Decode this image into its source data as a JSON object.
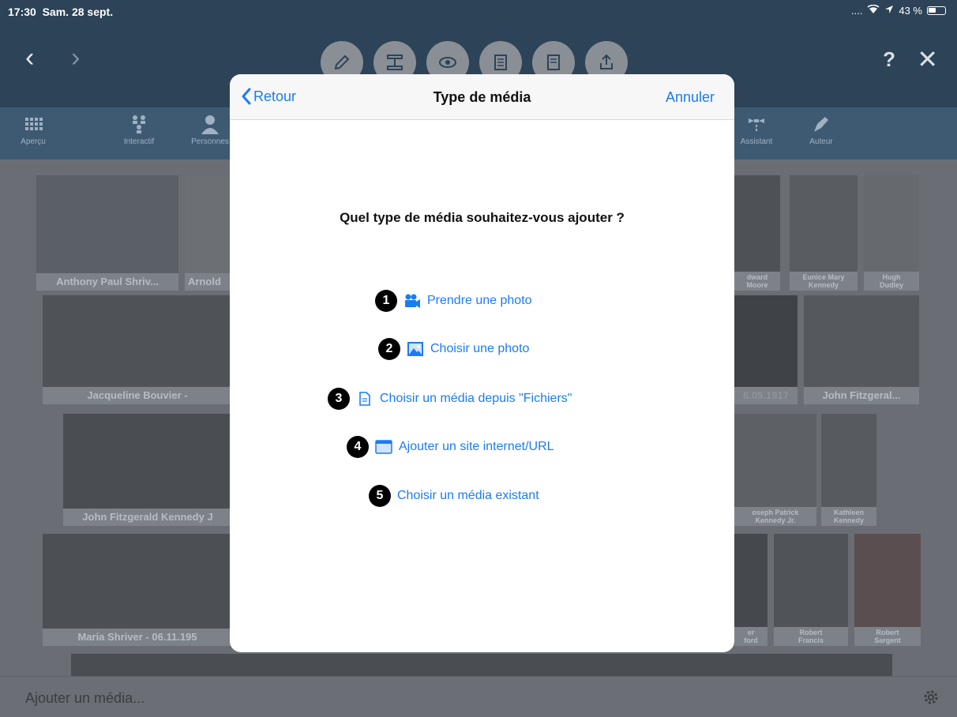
{
  "status_bar": {
    "time": "17:30",
    "date": "Sam. 28 sept.",
    "signal": "....",
    "battery": "43 %"
  },
  "toolbar": {
    "back_icon": "chevron-left-icon",
    "forward_icon": "chevron-right-icon",
    "tools": [
      "pencil-icon",
      "tree-icon",
      "eye-icon",
      "document-icon",
      "report-icon",
      "share-icon"
    ],
    "help": "?",
    "close": "✕"
  },
  "tabs": [
    {
      "label": "Aperçu",
      "icon": "grid-icon"
    },
    {
      "label": "Interactif",
      "icon": "tree-icon"
    },
    {
      "label": "Personnes",
      "icon": "person-icon"
    },
    {
      "label": "Assistant",
      "icon": "assistant-icon"
    },
    {
      "label": "Auteur",
      "icon": "pen-icon"
    }
  ],
  "persons": [
    {
      "name": "Anthony Paul Shriv..."
    },
    {
      "name": "Arnold"
    },
    {
      "name": "dward\nMoore"
    },
    {
      "name": "Eunice Mary\nKennedy"
    },
    {
      "name": "Hugh\nDudley"
    },
    {
      "name": "Jacqueline Bouvier - "
    },
    {
      "name": "6.05.1917"
    },
    {
      "name": "John Fitzgeral..."
    },
    {
      "name": "John Fitzgerald Kennedy J"
    },
    {
      "name": "oseph Patrick\nKennedy Jr."
    },
    {
      "name": "Kathleen\nKennedy"
    },
    {
      "name": "Maria Shriver - 06.11.195"
    },
    {
      "name": "er\nford"
    },
    {
      "name": "Robert\nFrancis"
    },
    {
      "name": "Robert\nSargent"
    }
  ],
  "bottom_bar": {
    "label": "Ajouter un média...",
    "icon": "gear-icon"
  },
  "modal": {
    "back_label": "Retour",
    "title": "Type de média",
    "cancel_label": "Annuler",
    "question": "Quel type de média souhaitez-vous ajouter ?",
    "options": [
      {
        "number": "1",
        "label": "Prendre une photo",
        "icon": "camera-icon"
      },
      {
        "number": "2",
        "label": "Choisir une photo",
        "icon": "photo-icon"
      },
      {
        "number": "3",
        "label": "Choisir un média depuis \"Fichiers\"",
        "icon": "file-icon"
      },
      {
        "number": "4",
        "label": "Ajouter un site internet/URL",
        "icon": "browser-icon"
      },
      {
        "number": "5",
        "label": "Choisir un média existant",
        "icon": ""
      }
    ],
    "accent_color": "#1a7cf5"
  }
}
